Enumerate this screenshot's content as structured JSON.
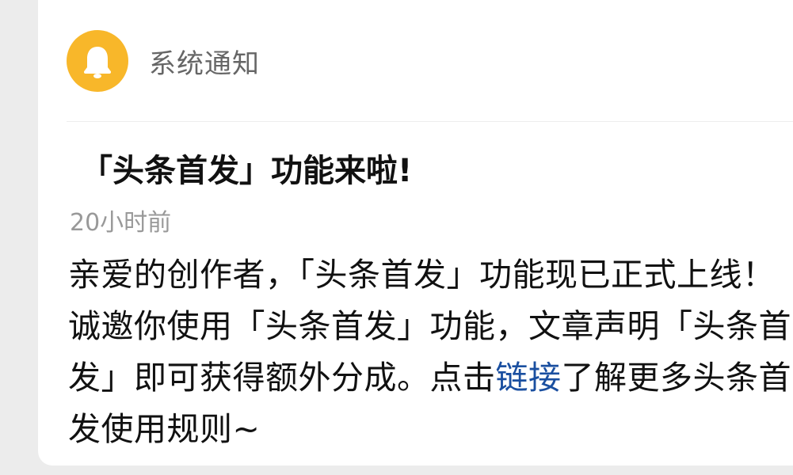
{
  "notification": {
    "sender": "系统通知",
    "icon": "bell-icon",
    "icon_color": "#f8b72a",
    "title": "「头条首发」功能来啦!",
    "time": "20小时前",
    "body_text": "亲爱的创作者，「头条首发」功能现已正式上线！诚邀你使用「头条首发」功能，文章声明「头条首发」即可获得额外分成。点击",
    "link_text": "链接",
    "link_color": "#1a4fa0",
    "body_tail": "了解更多头条首发使用规则~"
  }
}
